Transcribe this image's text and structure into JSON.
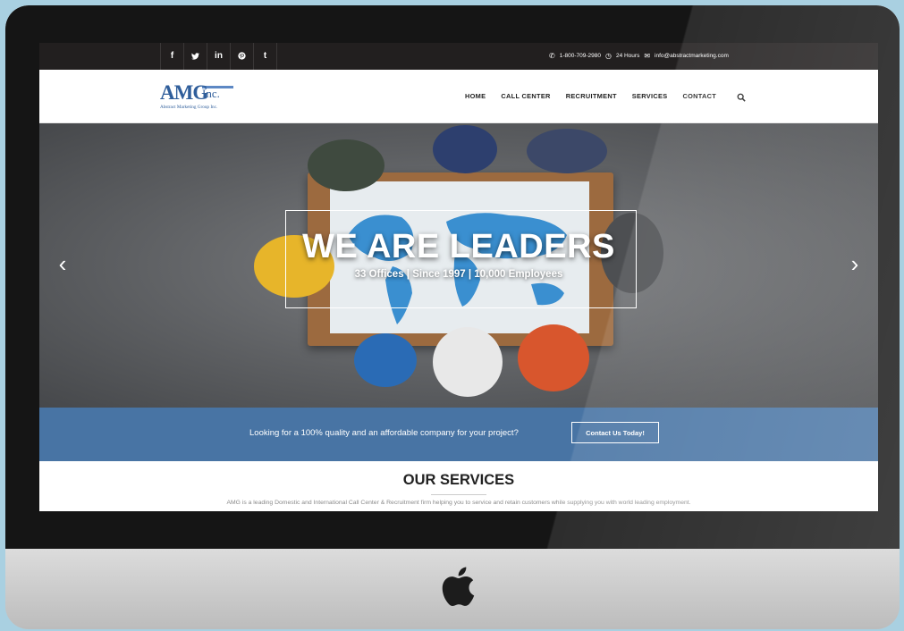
{
  "topbar": {
    "social": [
      "f",
      "𝕪",
      "in",
      "℗",
      "t"
    ],
    "phone": "1-800-709-2980",
    "hours": "24 Hours",
    "email": "info@abstractmarketing.com"
  },
  "logo": {
    "mark": "AMG",
    "inc": "Inc.",
    "tagline": "Abstract Marketing Group Inc."
  },
  "nav": {
    "items": [
      "HOME",
      "CALL CENTER",
      "RECRUITMENT",
      "SERVICES",
      "CONTACT"
    ]
  },
  "hero": {
    "title": "WE ARE LEADERS",
    "subtitle": "33 Offices | Since 1997 | 10,000 Employees",
    "prev": "‹",
    "next": "›"
  },
  "cta": {
    "text": "Looking for a 100% quality and an affordable company for your project?",
    "button": "Contact Us Today!"
  },
  "services": {
    "title": "OUR SERVICES",
    "description": "AMG is a leading Domestic and International Call Center & Recruitment firm helping you to service and retain customers while supplying you with world leading employment."
  },
  "colors": {
    "topbar": "#221f1f",
    "brand_blue": "#4874a4",
    "logo_blue": "#2f5e9b"
  }
}
